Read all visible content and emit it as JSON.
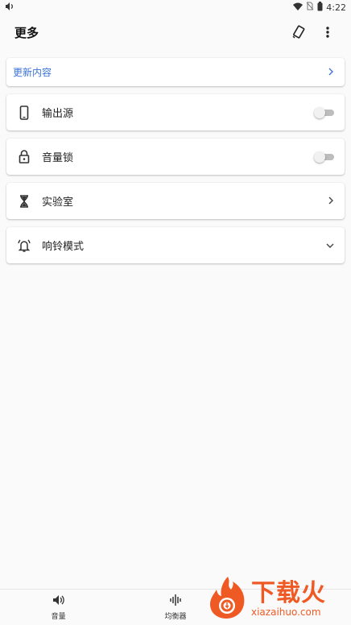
{
  "status_bar": {
    "time": "4:22"
  },
  "app_bar": {
    "title": "更多"
  },
  "update_card": {
    "label": "更新内容"
  },
  "rows": [
    {
      "label": "输出源",
      "icon": "phone-icon",
      "control": "toggle",
      "state": "off"
    },
    {
      "label": "音量锁",
      "icon": "lock-icon",
      "control": "toggle",
      "state": "off"
    },
    {
      "label": "实验室",
      "icon": "hourglass-icon",
      "control": "chevron-right"
    },
    {
      "label": "响铃模式",
      "icon": "bell-icon",
      "control": "chevron-down"
    }
  ],
  "bottom_nav": [
    {
      "label": "音量",
      "icon": "speaker-icon"
    },
    {
      "label": "均衡器",
      "icon": "equalizer-icon"
    }
  ],
  "watermark": {
    "big": "下载火",
    "small": "xiazaihuo.com"
  },
  "colors": {
    "accent": "#3b73d9",
    "watermark": "#ef5a24"
  }
}
